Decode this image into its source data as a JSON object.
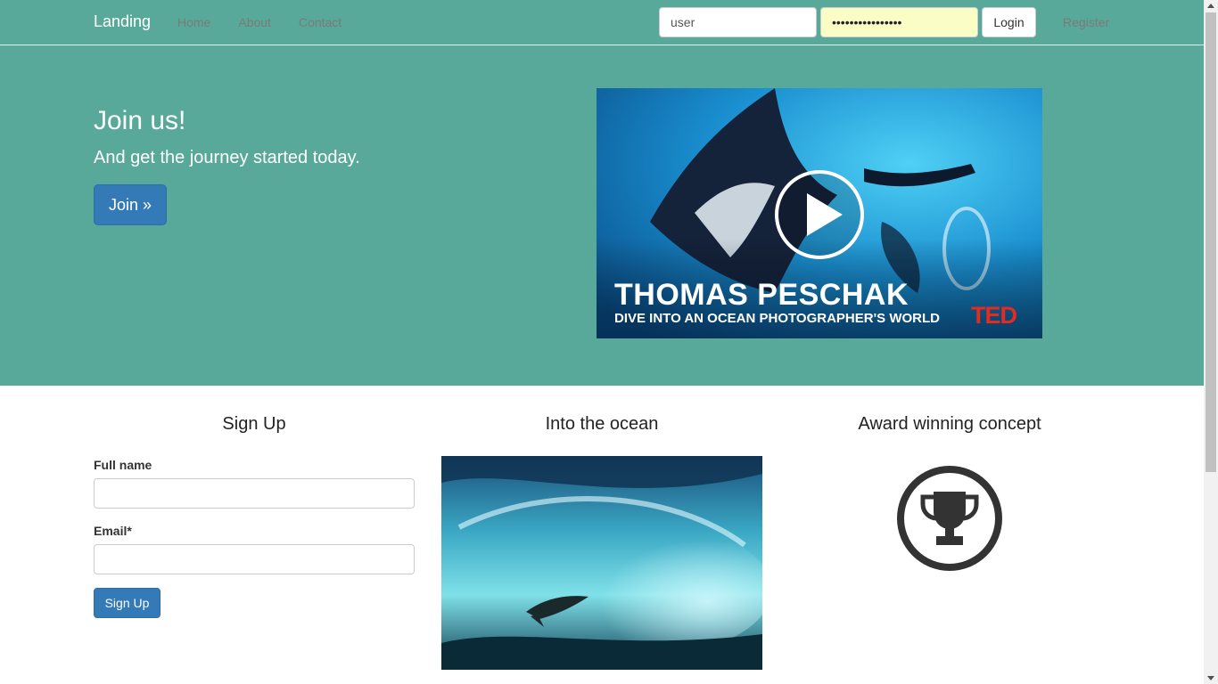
{
  "navbar": {
    "brand": "Landing",
    "links": [
      "Home",
      "About",
      "Contact"
    ],
    "login_user_value": "user",
    "login_password_value": "••••••••••••••••",
    "login_label": "Login",
    "register_label": "Register"
  },
  "hero": {
    "title": "Join us!",
    "subtitle": "And get the journey started today.",
    "join_label": "Join »",
    "video": {
      "title": "THOMAS PESCHAK",
      "subtitle": "DIVE INTO AN OCEAN PHOTOGRAPHER'S WORLD",
      "logo": "TED",
      "play_icon": "play-icon"
    }
  },
  "columns": {
    "signup": {
      "title": "Sign Up",
      "fullname_label": "Full name",
      "email_label": "Email*",
      "button_label": "Sign Up"
    },
    "ocean": {
      "title": "Into the ocean"
    },
    "award": {
      "title": "Award winning concept",
      "icon": "trophy-icon"
    }
  },
  "colors": {
    "header_bg": "#58a99a",
    "primary": "#337ab7",
    "ted_red": "#e62b1e"
  }
}
